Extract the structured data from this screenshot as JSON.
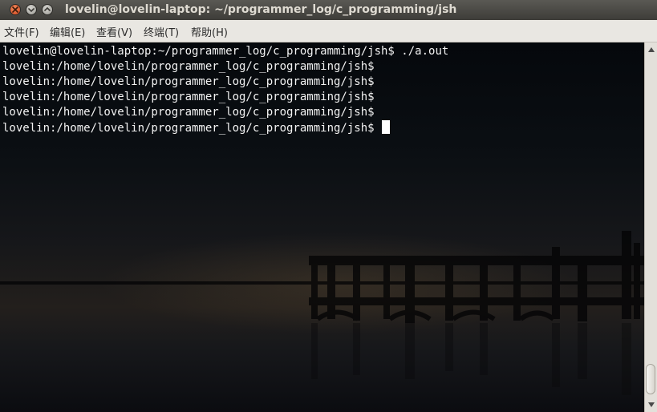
{
  "window": {
    "title": "lovelin@lovelin-laptop: ~/programmer_log/c_programming/jsh"
  },
  "menu": [
    {
      "label": "文件(F)"
    },
    {
      "label": "编辑(E)"
    },
    {
      "label": "查看(V)"
    },
    {
      "label": "终端(T)"
    },
    {
      "label": "帮助(H)"
    }
  ],
  "terminal": {
    "lines": [
      "lovelin@lovelin-laptop:~/programmer_log/c_programming/jsh$ ./a.out",
      "lovelin:/home/lovelin/programmer_log/c_programming/jsh$",
      "lovelin:/home/lovelin/programmer_log/c_programming/jsh$",
      "lovelin:/home/lovelin/programmer_log/c_programming/jsh$",
      "lovelin:/home/lovelin/programmer_log/c_programming/jsh$",
      "lovelin:/home/lovelin/programmer_log/c_programming/jsh$ "
    ]
  },
  "icons": {
    "close": "close-icon",
    "minimize": "minimize-icon",
    "maximize": "maximize-icon",
    "scroll_up": "arrow-up-icon",
    "scroll_down": "arrow-down-icon"
  },
  "colors": {
    "close_button": "#e0522a",
    "terminal_text": "#f2f2f2",
    "menubar_bg": "#e9e7e2",
    "titlebar_bg": "#3d3c38"
  },
  "scrollbar": {
    "position_fraction": 1.0
  }
}
